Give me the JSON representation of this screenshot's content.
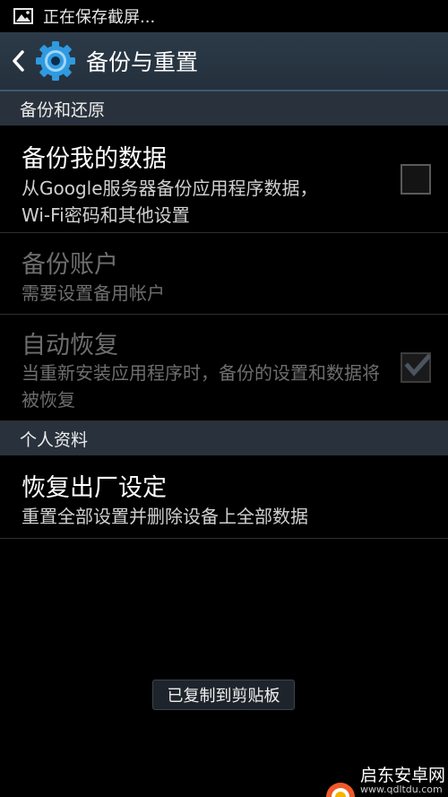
{
  "status_bar": {
    "text": "正在保存截屏..."
  },
  "action_bar": {
    "title": "备份与重置"
  },
  "sections": [
    {
      "header": "备份和还原",
      "items": [
        {
          "title": "备份我的数据",
          "summary": "从Google服务器备份应用程序数据，Wi-Fi密码和其他设置",
          "checked": false,
          "enabled": true
        },
        {
          "title": "备份账户",
          "summary": "需要设置备用帐户",
          "enabled": false
        },
        {
          "title": "自动恢复",
          "summary": "当重新安装应用程序时，备份的设置和数据将被恢复",
          "checked": true,
          "enabled": false
        }
      ]
    },
    {
      "header": "个人资料",
      "items": [
        {
          "title": "恢复出厂设定",
          "summary": "重置全部设置并删除设备上全部数据",
          "enabled": true
        }
      ]
    }
  ],
  "toast": {
    "text": "已复制到剪贴板"
  },
  "watermark": {
    "name": "启东安卓网",
    "url": "www.qdltdu.com"
  },
  "colors": {
    "action_bar": "#2c3a48",
    "section_header": "#29323c",
    "disabled_text": "#6e6e6e",
    "gear_blue": "#2f9ae0"
  },
  "icons": {
    "status": "picture-icon",
    "back": "chevron-left-icon",
    "app": "gear-icon",
    "checkmark": "check-icon"
  }
}
